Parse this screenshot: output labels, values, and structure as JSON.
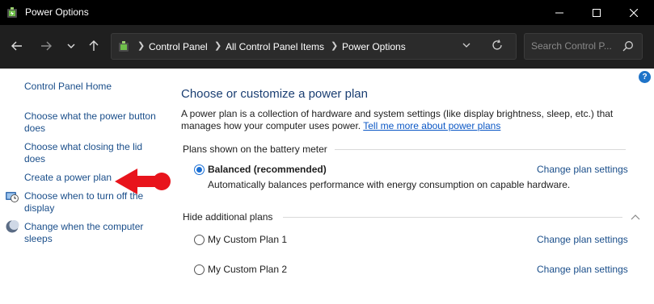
{
  "window": {
    "title": "Power Options",
    "minimize_icon": "minimize-icon",
    "maximize_icon": "maximize-icon",
    "close_icon": "close-icon"
  },
  "nav": {
    "breadcrumbs": [
      "Control Panel",
      "All Control Panel Items",
      "Power Options"
    ],
    "search_placeholder": "Search Control P..."
  },
  "sidebar": {
    "home": "Control Panel Home",
    "links": [
      {
        "line1": "Choose what the power button",
        "line2": "does"
      },
      {
        "line1": "Choose what closing the lid",
        "line2": "does"
      },
      {
        "line1": "Create a power plan",
        "line2": ""
      },
      {
        "line1": "Choose when to turn off the",
        "line2": "display"
      },
      {
        "line1": "Change when the computer",
        "line2": "sleeps"
      }
    ]
  },
  "main": {
    "help": "?",
    "heading": "Choose or customize a power plan",
    "description_line1": "A power plan is a collection of hardware and system settings (like display brightness, sleep, etc.) that",
    "description_line2": "manages how your computer uses power.",
    "learn_more_link": "Tell me more about power plans",
    "battery_group_label": "Plans shown on the battery meter",
    "hidden_group_label": "Hide additional plans",
    "change_settings_label": "Change plan settings",
    "plans": [
      {
        "name": "Balanced (recommended)",
        "selected": true,
        "description": "Automatically balances performance with energy consumption on capable hardware."
      },
      {
        "name": "My Custom Plan 1",
        "selected": false,
        "description": ""
      },
      {
        "name": "My Custom Plan 2",
        "selected": false,
        "description": ""
      }
    ]
  },
  "colors": {
    "link": "#1a4e8a",
    "heading": "#1a3e72",
    "annotation_arrow": "#e8141c",
    "titlebar": "#000000"
  }
}
